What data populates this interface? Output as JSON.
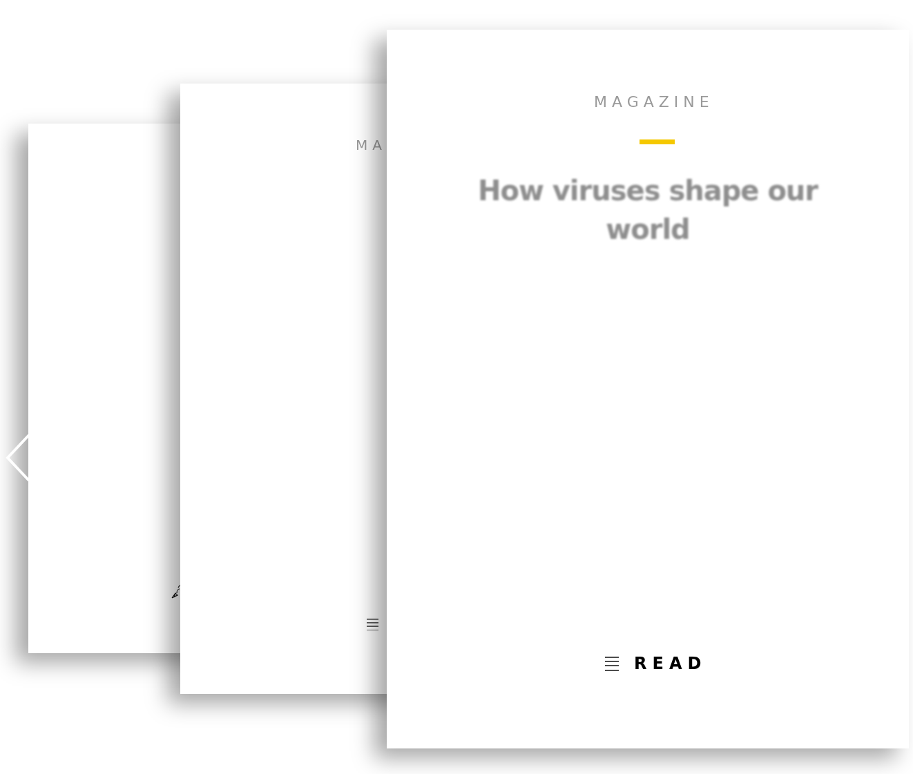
{
  "cards": [
    {
      "kind": "back"
    },
    {
      "kind": "middle",
      "section": "MA"
    },
    {
      "kind": "front",
      "section": "MAGAZINE",
      "title": "How viruses shape our world",
      "action": "READ"
    }
  ]
}
